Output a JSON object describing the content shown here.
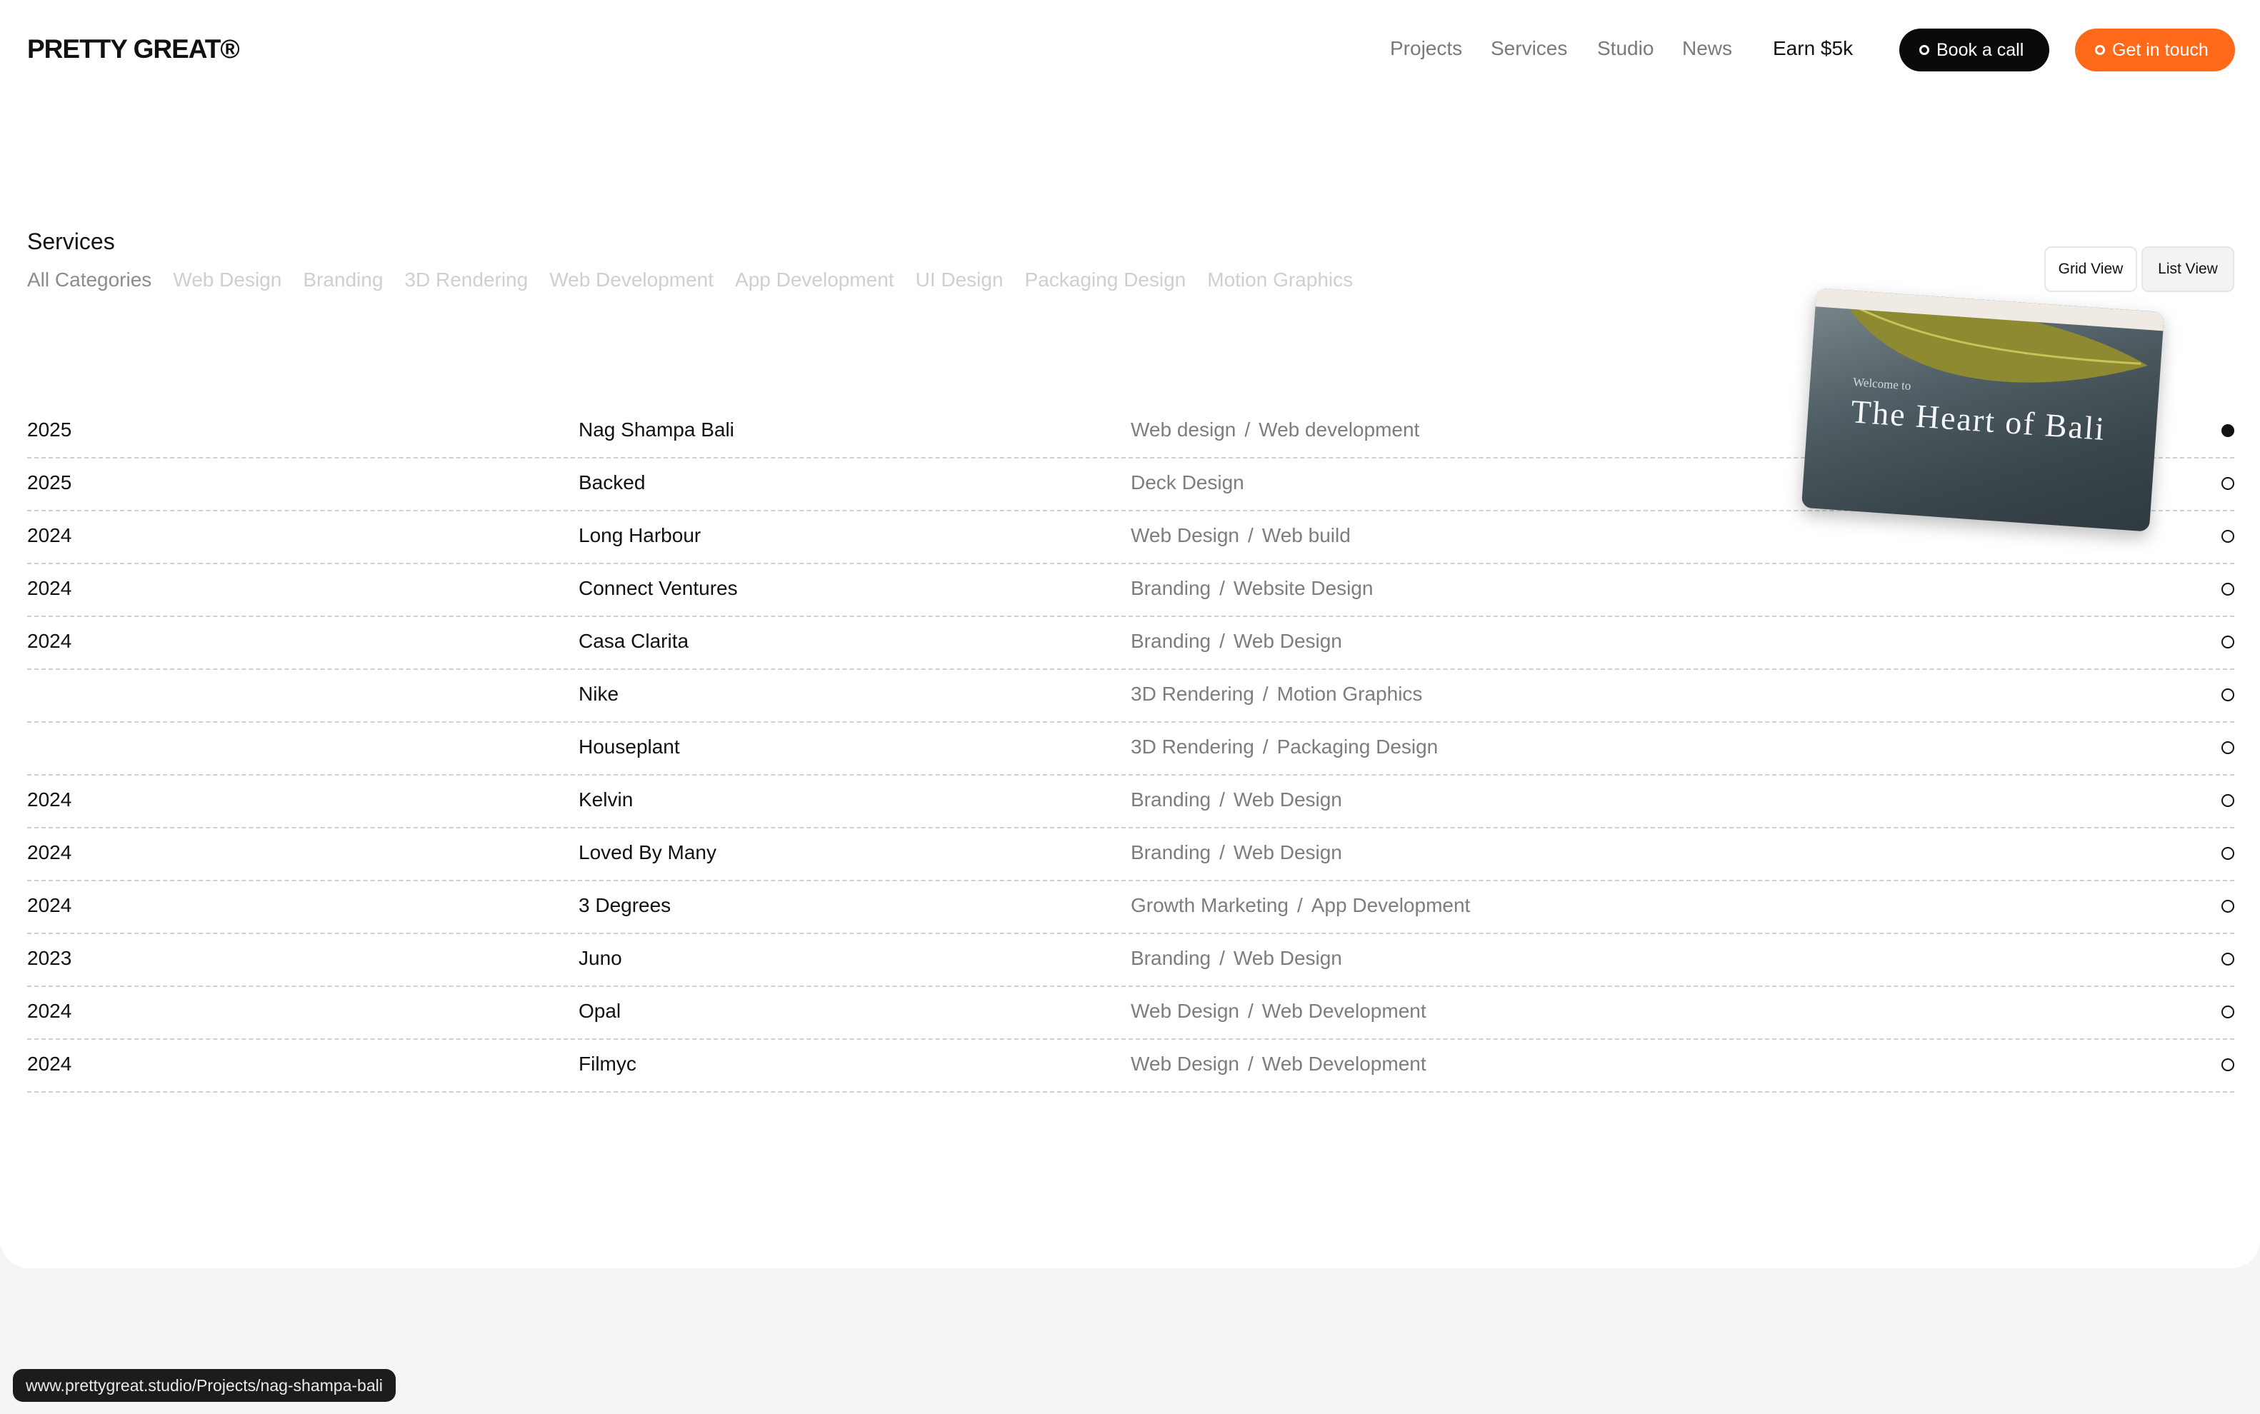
{
  "header": {
    "logo": "PRETTY GREAT®",
    "nav": [
      "Projects",
      "Services",
      "Studio",
      "News"
    ],
    "earn": "Earn $5k",
    "book_call": "Book a call",
    "get_in_touch": "Get in touch",
    "colors": {
      "book_bg": "#0a0a0a",
      "touch_bg": "#ff6a1a"
    }
  },
  "filters": {
    "title": "Services",
    "categories": [
      "All Categories",
      "Web Design",
      "Branding",
      "3D Rendering",
      "Web Development",
      "App Development",
      "UI Design",
      "Packaging Design",
      "Motion Graphics"
    ],
    "active_category": "All Categories",
    "grid_view": "Grid View",
    "list_view": "List View",
    "active_view": "List View"
  },
  "projects": [
    {
      "year": "2025",
      "name": "Nag Shampa Bali",
      "tags": [
        "Web design",
        "Web development"
      ],
      "selected": true
    },
    {
      "year": "2025",
      "name": "Backed",
      "tags": [
        "Deck Design"
      ],
      "selected": false
    },
    {
      "year": "2024",
      "name": "Long Harbour",
      "tags": [
        "Web Design",
        "Web build"
      ],
      "selected": false
    },
    {
      "year": "2024",
      "name": "Connect Ventures",
      "tags": [
        "Branding",
        "Website Design"
      ],
      "selected": false
    },
    {
      "year": "2024",
      "name": "Casa Clarita",
      "tags": [
        "Branding",
        "Web Design"
      ],
      "selected": false
    },
    {
      "year": "",
      "name": "Nike",
      "tags": [
        "3D Rendering",
        "Motion Graphics"
      ],
      "selected": false
    },
    {
      "year": "",
      "name": "Houseplant",
      "tags": [
        "3D Rendering",
        "Packaging Design"
      ],
      "selected": false
    },
    {
      "year": "2024",
      "name": "Kelvin",
      "tags": [
        "Branding",
        "Web Design"
      ],
      "selected": false
    },
    {
      "year": "2024",
      "name": "Loved By Many",
      "tags": [
        "Branding",
        "Web Design"
      ],
      "selected": false
    },
    {
      "year": "2024",
      "name": "3 Degrees",
      "tags": [
        "Growth Marketing",
        "App Development"
      ],
      "selected": false
    },
    {
      "year": "2023",
      "name": "Juno",
      "tags": [
        "Branding",
        "Web Design"
      ],
      "selected": false
    },
    {
      "year": "2024",
      "name": "Opal",
      "tags": [
        "Web Design",
        "Web Development"
      ],
      "selected": false
    },
    {
      "year": "2024",
      "name": "Filmyc",
      "tags": [
        "Web Design",
        "Web Development"
      ],
      "selected": false
    }
  ],
  "preview": {
    "welcome": "Welcome to",
    "headline": "The Heart of Bali"
  },
  "status_url": "www.prettygreat.studio/Projects/nag-shampa-bali"
}
